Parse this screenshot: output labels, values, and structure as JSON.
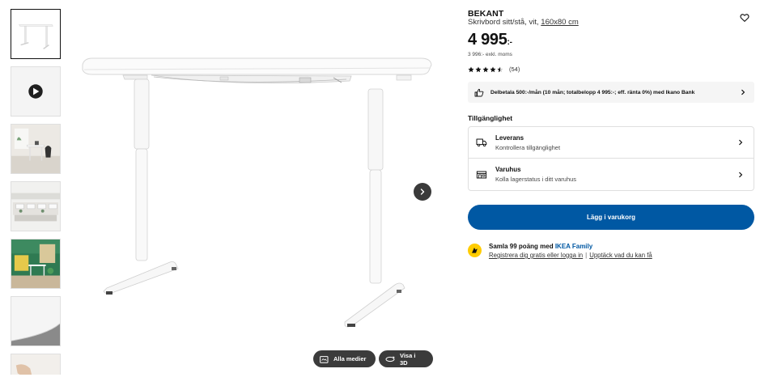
{
  "product": {
    "name": "BEKANT",
    "desc_prefix": "Skrivbord sitt/stå, vit, ",
    "size_link": "160x80 cm",
    "price_main": "4 995",
    "price_suffix": ":-",
    "price_ex_vat": "3 996:- exkl. moms",
    "rating_value": 4.5,
    "rating_count": "(54)"
  },
  "finance": {
    "text": "Delbetala 500:-/mån (10 mån; totalbelopp 4 995:-; eff. ränta 0%) med Ikano Bank",
    "icon": "thumbs-up-icon"
  },
  "availability": {
    "title": "Tillgänglighet",
    "rows": [
      {
        "heading": "Leverans",
        "sub": "Kontrollera tillgänglighet",
        "icon": "truck-icon"
      },
      {
        "heading": "Varuhus",
        "sub": "Kolla lagerstatus i ditt varuhus",
        "icon": "store-icon"
      }
    ]
  },
  "cart": {
    "label": "Lägg i varukorg"
  },
  "family": {
    "line1_prefix": "Samla 99 poäng med ",
    "line1_link": "IKEA Family",
    "link_login": "Registrera dig gratis eller logga in",
    "separator": "|",
    "link_discover": "Upptäck vad du kan få"
  },
  "media": {
    "all_label": "Alla medier",
    "view3d_label": "Visa i 3D"
  },
  "colors": {
    "brand_blue": "#0058a3",
    "family_yellow": "#ffcc00",
    "button_dark": "#3b3b3b"
  }
}
